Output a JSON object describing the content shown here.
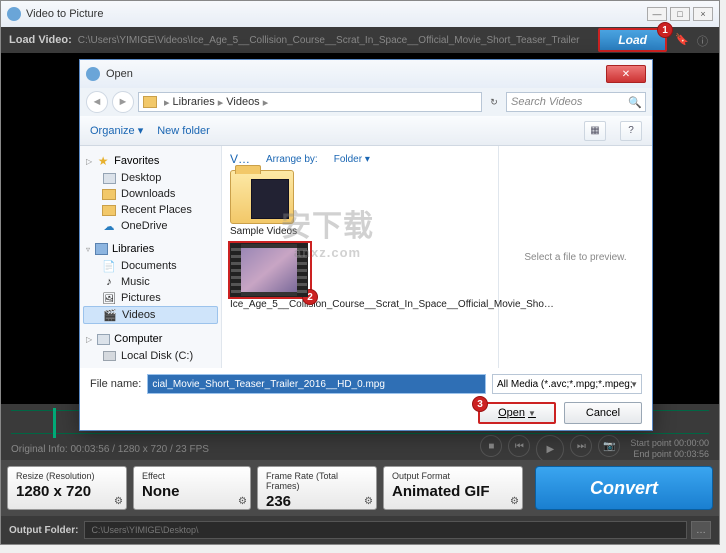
{
  "app": {
    "title": "Video to Picture",
    "win_min": "—",
    "win_max": "□",
    "win_close": "×"
  },
  "loadbar": {
    "label": "Load Video:",
    "path": "C:\\Users\\YIMIGE\\Videos\\Ice_Age_5__Collision_Course__Scrat_In_Space__Official_Movie_Short_Teaser_Trailer",
    "button": "Load",
    "badge": "1"
  },
  "dialog": {
    "title": "Open",
    "nav_back": "◄",
    "nav_fwd": "►",
    "address": {
      "root": "Libraries",
      "sub": "Videos"
    },
    "search_placeholder": "Search Videos",
    "tools": {
      "organize": "Organize ▾",
      "newfolder": "New folder",
      "view": "▦",
      "help": "?"
    },
    "sidebar": {
      "favorites": {
        "label": "Favorites",
        "items": [
          "Desktop",
          "Downloads",
          "Recent Places",
          "OneDrive"
        ]
      },
      "libraries": {
        "label": "Libraries",
        "items": [
          "Documents",
          "Music",
          "Pictures",
          "Videos"
        ],
        "selected": "Videos"
      },
      "computer": {
        "label": "Computer",
        "items": [
          "Local Disk (C:)"
        ]
      }
    },
    "filepane": {
      "heading": "V…",
      "arrange_label": "Arrange by:",
      "arrange_value": "Folder ▾",
      "folder_name": "Sample Videos",
      "video_name": "Ice_Age_5__Collision_Course__Scrat_In_Space__Official_Movie_Sho…",
      "badge": "2"
    },
    "preview": "Select a file to preview.",
    "footer": {
      "filename_label": "File name:",
      "filename_value": "cial_Movie_Short_Teaser_Trailer_2016__HD_0.mpg",
      "filter": "All Media (*.avc;*.mpg;*.mpeg;",
      "open": "Open",
      "open_badge": "3",
      "cancel": "Cancel"
    }
  },
  "info": {
    "original": "Original Info: 00:03:56 / 1280 x 720 / 23 FPS",
    "start_label": "Start point",
    "start_val": "00:00:00",
    "end_label": "End point",
    "end_val": "00:03:56"
  },
  "options": {
    "resize": {
      "title": "Resize (Resolution)",
      "value": "1280 x 720"
    },
    "effect": {
      "title": "Effect",
      "value": "None"
    },
    "framerate": {
      "title": "Frame Rate (Total Frames)",
      "value": "236"
    },
    "format": {
      "title": "Output Format",
      "value": "Animated GIF"
    }
  },
  "convert": "Convert",
  "output": {
    "label": "Output Folder:",
    "path": "C:\\Users\\YIMIGE\\Desktop\\",
    "browse": "…"
  },
  "watermark": {
    "main": "安下载",
    "sub": "anxz.com"
  }
}
